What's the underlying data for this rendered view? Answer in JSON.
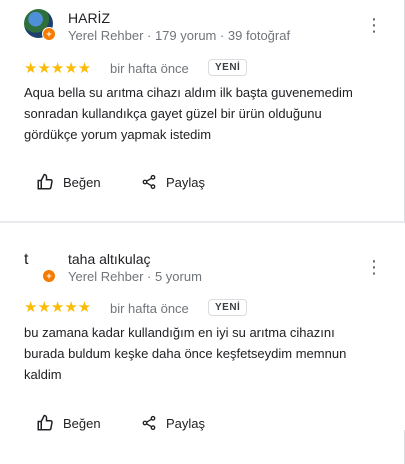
{
  "reviews": [
    {
      "name": "HARİZ",
      "meta": "Yerel Rehber · 179 yorum · 39 fotoğraf",
      "stars": "★★★★★",
      "rating": 5,
      "time": "bir hafta önce",
      "badge": "YENİ",
      "text": "Aqua bella su arıtma cihazı aldım ilk başta guvenemedim sonradan kullandıkça gayet güzel bir ürün olduğunu gördükçe yorum yapmak istedim",
      "like_label": "Beğen",
      "share_label": "Paylaş"
    },
    {
      "name": "taha altıkulaç",
      "avatar_letter": "t",
      "meta": "Yerel Rehber · 5 yorum",
      "stars": "★★★★★",
      "rating": 5,
      "time": "bir hafta önce",
      "badge": "YENİ",
      "text": "bu zamana kadar kullandığım en iyi su arıtma cihazını burada buldum keşke daha önce keşfetseydim memnun kaldim",
      "like_label": "Beğen",
      "share_label": "Paylaş"
    }
  ],
  "colors": {
    "star": "#fbbc04",
    "local_guide_badge": "#f57c00",
    "meta_text": "#70757a"
  },
  "icons": [
    "thumbs-up-icon",
    "share-icon",
    "more-vert-icon",
    "local-guide-badge-icon"
  ]
}
